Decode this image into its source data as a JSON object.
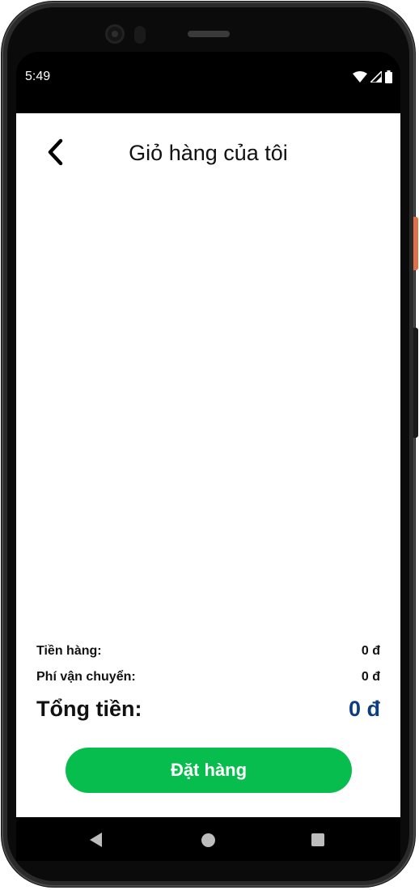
{
  "status_bar": {
    "time": "5:49",
    "icons": [
      "wifi-icon",
      "cellular-icon",
      "battery-icon"
    ]
  },
  "header": {
    "back_icon": "chevron-left-icon",
    "title": "Giỏ hàng của tôi"
  },
  "summary": {
    "subtotal_label": "Tiền hàng:",
    "subtotal_value": "0 đ",
    "shipping_label": "Phí vận chuyển:",
    "shipping_value": "0 đ",
    "total_label": "Tổng tiền:",
    "total_value": "0 đ"
  },
  "order_button": {
    "label": "Đặt hàng"
  },
  "nav_bar": {
    "icons": [
      "nav-back-icon",
      "nav-home-icon",
      "nav-recents-icon"
    ]
  },
  "colors": {
    "accent_green": "#07bd4e",
    "total_blue": "#0c3d80",
    "text": "#111111",
    "screen_background": "#ffffff"
  }
}
